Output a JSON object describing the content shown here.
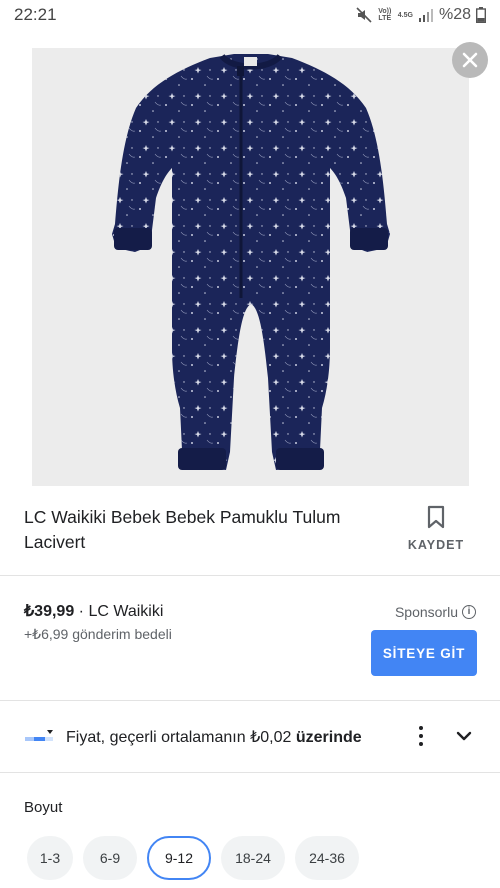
{
  "status_bar": {
    "time": "22:21",
    "volte": "Vo)) LTE",
    "network": "4.5G",
    "battery": "%28"
  },
  "product": {
    "title": "LC Waikiki Bebek Bebek Pamuklu Tulum Lacivert",
    "save_label": "KAYDET"
  },
  "offer": {
    "price": "₺39,99",
    "seller": " · LC Waikiki",
    "shipping": "+₺6,99 gönderim bedeli",
    "sponsored": "Sponsorlu",
    "visit_button": "SİTEYE GİT"
  },
  "price_insight": {
    "text_prefix": "Fiyat, geçerli ortalamanın ₺0,02 ",
    "text_bold": "üzerinde"
  },
  "size": {
    "label": "Boyut",
    "options": [
      "1-3",
      "6-9",
      "9-12",
      "18-24",
      "24-36"
    ],
    "selected": "9-12"
  },
  "colors": {
    "accent": "#4285f4",
    "garment": "#1b2559",
    "image_bg": "#ececec"
  }
}
